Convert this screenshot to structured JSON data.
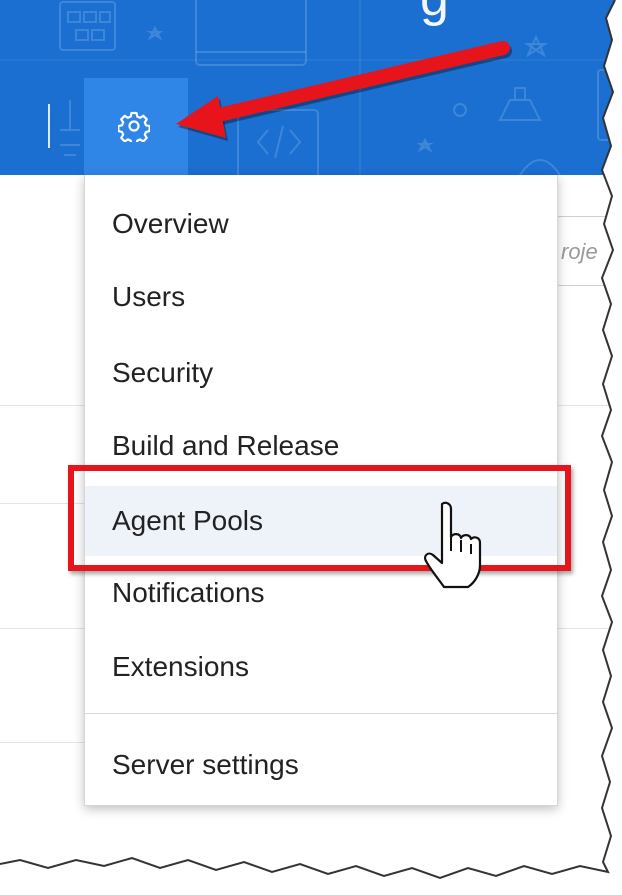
{
  "header": {
    "title_fragment": "g",
    "background_color": "#1a6fd0",
    "settings_button_icon": "gear-icon",
    "settings_button_active_color": "#2f86e6"
  },
  "search": {
    "placeholder_fragment": "roje"
  },
  "menu": {
    "items": [
      {
        "label": "Overview"
      },
      {
        "label": "Users"
      },
      {
        "label": "Security"
      },
      {
        "label": "Build and Release"
      },
      {
        "label": "Agent Pools",
        "hovered": true
      },
      {
        "label": "Notifications"
      },
      {
        "label": "Extensions"
      }
    ],
    "footer_item": {
      "label": "Server settings"
    }
  },
  "annotations": {
    "arrow_color": "#e8141b",
    "highlight_color": "#e8141b",
    "cursor_icon": "hand-pointer-icon"
  }
}
